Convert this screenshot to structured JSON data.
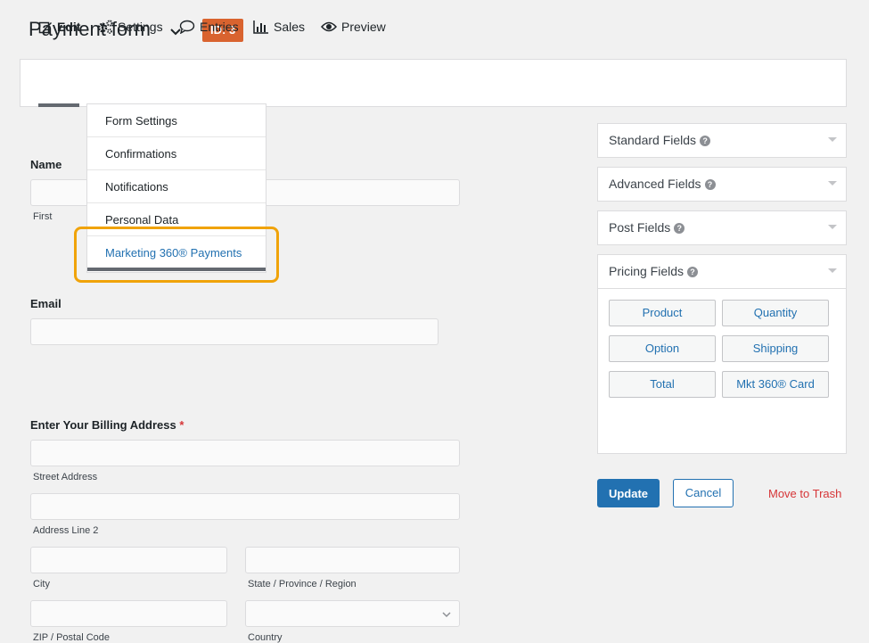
{
  "header": {
    "title": "Payment form",
    "id_badge": "ID: 3"
  },
  "toolbar": {
    "tabs": [
      {
        "label": "Edit",
        "icon": "edit-icon"
      },
      {
        "label": "Settings",
        "icon": "gears-icon"
      },
      {
        "label": "Entries",
        "icon": "comment-icon"
      },
      {
        "label": "Sales",
        "icon": "bar-chart-icon"
      },
      {
        "label": "Preview",
        "icon": "eye-icon"
      }
    ]
  },
  "settings_menu": {
    "items": [
      "Form Settings",
      "Confirmations",
      "Notifications",
      "Personal Data",
      "Marketing 360® Payments"
    ]
  },
  "form": {
    "name": {
      "label": "Name",
      "first": "First",
      "last_partial": "t"
    },
    "email": {
      "label": "Email"
    },
    "billing": {
      "label": "Enter Your Billing Address",
      "required_mark": "*",
      "street": "Street Address",
      "line2": "Address Line 2",
      "city": "City",
      "state": "State / Province / Region",
      "zip": "ZIP / Postal Code",
      "country": "Country"
    }
  },
  "sidebar": {
    "panels": [
      {
        "title": "Standard Fields"
      },
      {
        "title": "Advanced Fields"
      },
      {
        "title": "Post Fields"
      },
      {
        "title": "Pricing Fields"
      }
    ],
    "pricing_buttons": [
      "Product",
      "Quantity",
      "Option",
      "Shipping",
      "Total",
      "Mkt 360® Card"
    ]
  },
  "actions": {
    "update": "Update",
    "cancel": "Cancel",
    "trash": "Move to Trash"
  },
  "colors": {
    "accent": "#2271b1",
    "badge": "#d9632f",
    "highlight": "#f0a30a",
    "danger": "#d63638"
  }
}
